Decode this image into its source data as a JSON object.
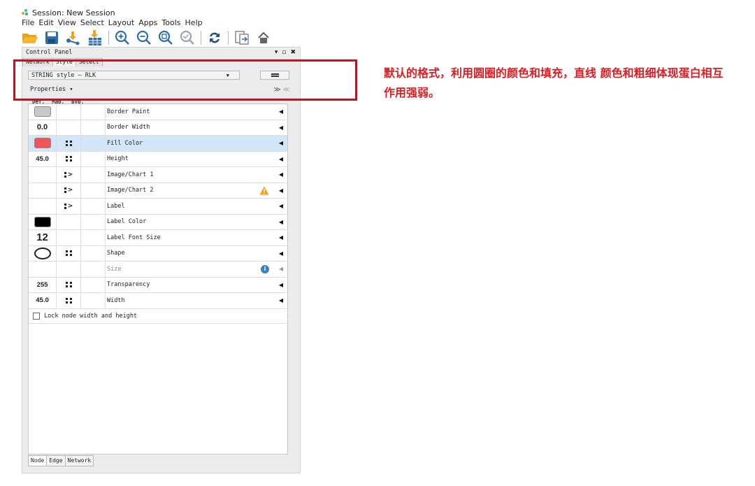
{
  "window": {
    "title": "Session: New Session",
    "menu": [
      "File",
      "Edit",
      "View",
      "Select",
      "Layout",
      "Apps",
      "Tools",
      "Help"
    ]
  },
  "toolbar": {
    "icons": [
      "open-folder-icon",
      "save-icon",
      "import-network-icon",
      "import-table-icon",
      "zoom-in-icon",
      "zoom-out-icon",
      "zoom-fit-icon",
      "zoom-selected-icon",
      "refresh-icon",
      "export-icon",
      "home-icon"
    ]
  },
  "control_panel": {
    "title": "Control Panel",
    "tabs": [
      "Network",
      "Style",
      "Select"
    ],
    "active_tab": "Style",
    "style_select": "STRING style – RLK",
    "properties_label": "Properties",
    "column_headers": [
      "Def.",
      "Map.",
      "Byp."
    ],
    "properties": [
      {
        "name": "Border Paint",
        "def_type": "swatch",
        "def": "",
        "def_color": "#c8c8c8",
        "map": "",
        "byp": "",
        "status": ""
      },
      {
        "name": "Border Width",
        "def_type": "number",
        "def": "0.0",
        "def_color": "",
        "map": "",
        "byp": "",
        "status": ""
      },
      {
        "name": "Fill Color",
        "def_type": "swatch",
        "def": "",
        "def_color": "#f2545b",
        "map": "mapped",
        "byp": "",
        "status": "",
        "selected": true
      },
      {
        "name": "Height",
        "def_type": "number-small",
        "def": "45.0",
        "def_color": "",
        "map": "mapped",
        "byp": "",
        "status": ""
      },
      {
        "name": "Image/Chart 1",
        "def_type": "empty",
        "def": "",
        "def_color": "",
        "map": "passthrough",
        "byp": "",
        "status": ""
      },
      {
        "name": "Image/Chart 2",
        "def_type": "empty",
        "def": "",
        "def_color": "",
        "map": "passthrough",
        "byp": "",
        "status": "warning"
      },
      {
        "name": "Label",
        "def_type": "empty",
        "def": "",
        "def_color": "",
        "map": "passthrough",
        "byp": "",
        "status": ""
      },
      {
        "name": "Label Color",
        "def_type": "swatch",
        "def": "",
        "def_color": "#000000",
        "map": "",
        "byp": "",
        "status": ""
      },
      {
        "name": "Label Font Size",
        "def_type": "number-big",
        "def": "12",
        "def_color": "",
        "map": "",
        "byp": "",
        "status": ""
      },
      {
        "name": "Shape",
        "def_type": "ellipse",
        "def": "",
        "def_color": "",
        "map": "mapped",
        "byp": "",
        "status": ""
      },
      {
        "name": "Size",
        "def_type": "empty",
        "def": "",
        "def_color": "",
        "map": "",
        "byp": "",
        "status": "info",
        "disabled": true
      },
      {
        "name": "Transparency",
        "def_type": "number-small",
        "def": "255",
        "def_color": "",
        "map": "mapped",
        "byp": "",
        "status": ""
      },
      {
        "name": "Width",
        "def_type": "number-small",
        "def": "45.0",
        "def_color": "",
        "map": "mapped",
        "byp": "",
        "status": ""
      }
    ],
    "lock_label": "Lock node width and height",
    "lock_checked": false,
    "bottom_tabs": [
      "Node",
      "Edge",
      "Network"
    ],
    "active_bottom_tab": "Node"
  },
  "annotation": {
    "text": "默认的格式，利用圆圈的颜色和填充，直线 颜色和粗细体现蛋白相互作用强弱。",
    "color": "#e01b22"
  }
}
